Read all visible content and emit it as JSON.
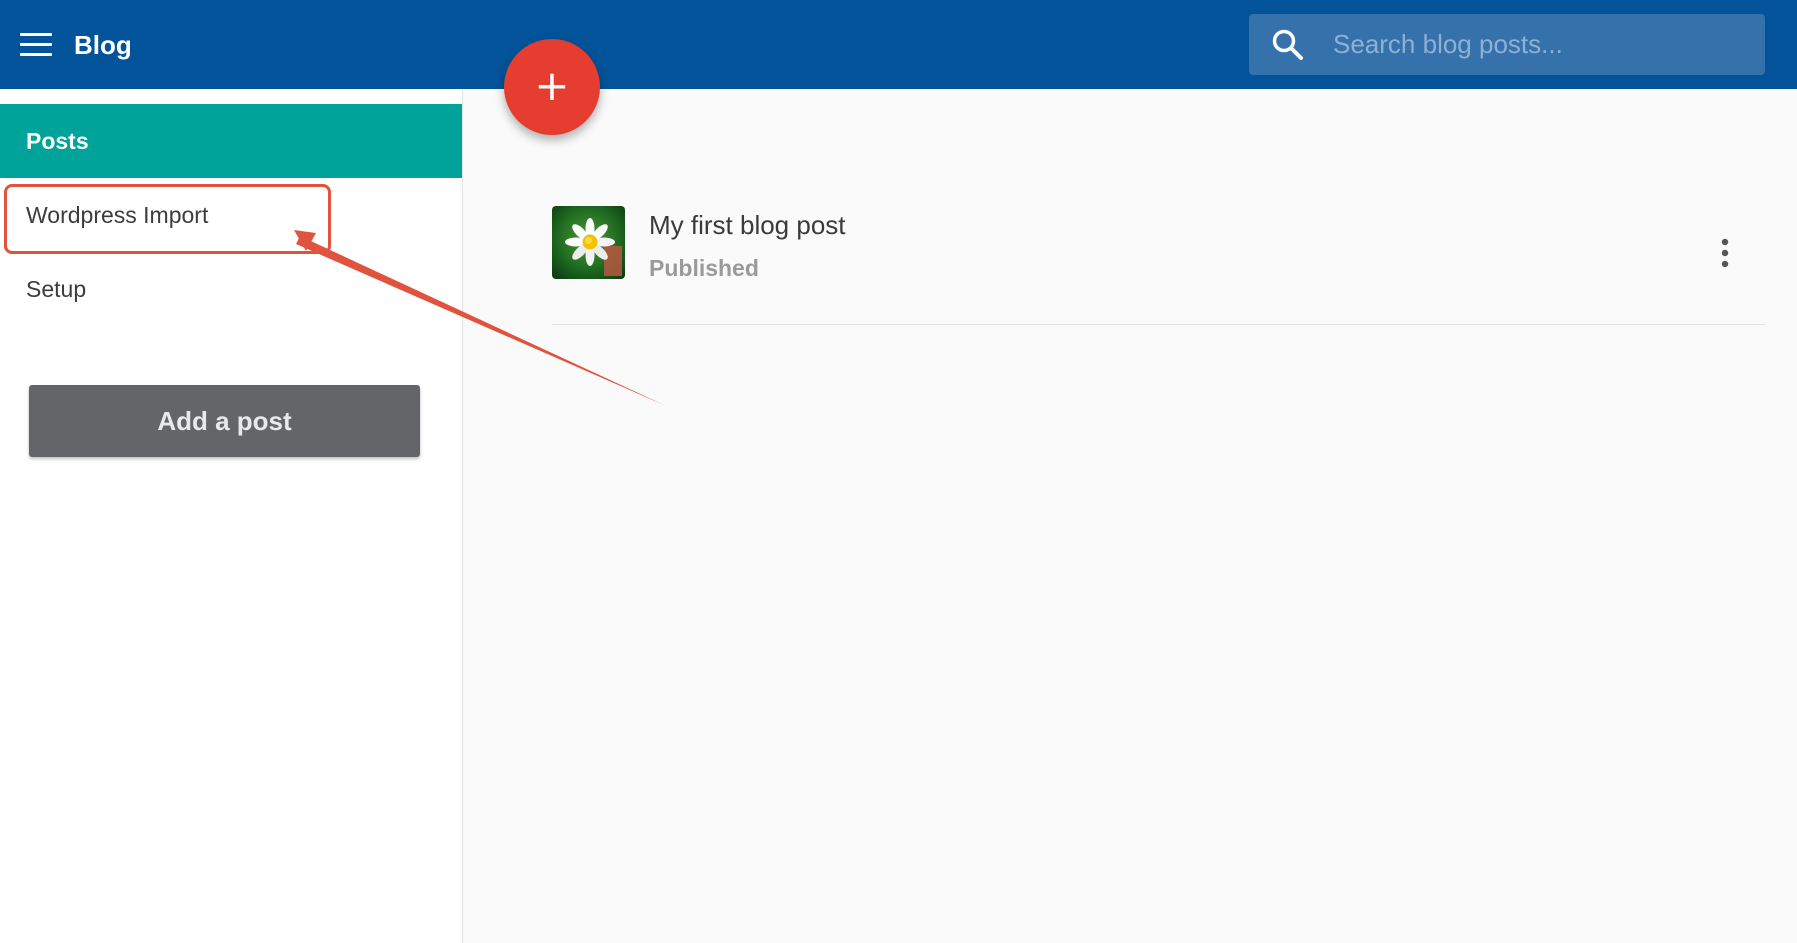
{
  "header": {
    "title": "Blog",
    "menu_icon": "hamburger-menu-icon",
    "search": {
      "placeholder": "Search blog posts..."
    }
  },
  "fab": {
    "label": "+"
  },
  "sidebar": {
    "items": [
      {
        "label": "Posts",
        "active": true
      },
      {
        "label": "Wordpress Import",
        "active": false
      },
      {
        "label": "Setup",
        "active": false
      }
    ],
    "add_post_label": "Add a post"
  },
  "posts": [
    {
      "title": "My first blog post",
      "status": "Published",
      "thumbnail": "daisy-flower-image"
    }
  ],
  "colors": {
    "header": "#025399",
    "active_nav": "#00a39a",
    "fab": "#e53e30",
    "annotation": "#e0533e",
    "button": "#636568"
  }
}
